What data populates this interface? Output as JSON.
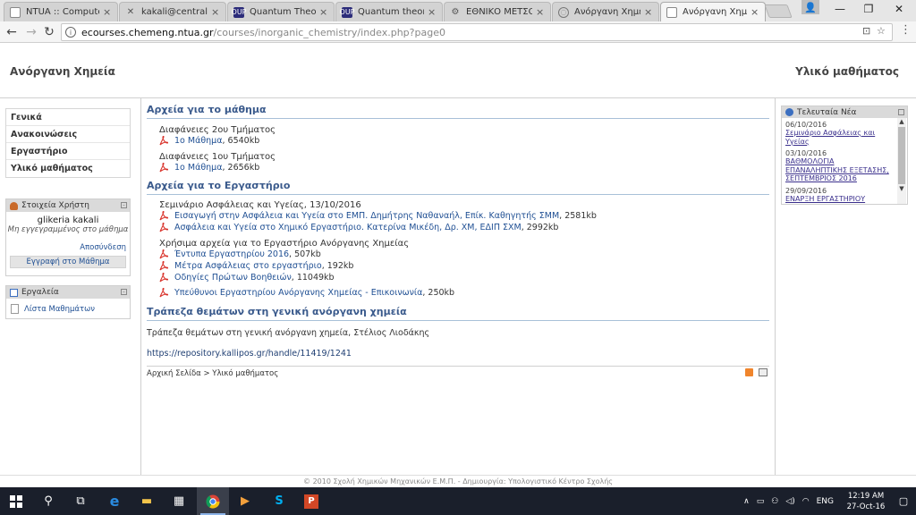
{
  "browser": {
    "tabs": [
      {
        "title": "NTUA :: Computer",
        "fav": "globe-icon",
        "active": false
      },
      {
        "title": "kakali@central.ntua",
        "fav": "mail-icon",
        "active": false
      },
      {
        "title": "Quantum Theory",
        "fav": "oup-icon",
        "active": false
      },
      {
        "title": "Quantum theory -",
        "fav": "oup-icon",
        "active": false
      },
      {
        "title": "ΕΘΝΙΚΟ ΜΕΤΣΟΒΙ",
        "fav": "ntua-icon",
        "active": false
      },
      {
        "title": "Ανόργανη Χημεία",
        "fav": "globe-icon",
        "active": false
      },
      {
        "title": "Ανόργανη Χημεία",
        "fav": "page-icon",
        "active": true
      }
    ],
    "oup_label": "OUP",
    "url_host": "ecourses.chemeng.ntua.gr",
    "url_path": "/courses/inorganic_chemistry/index.php?page0"
  },
  "header": {
    "title": "Ανόργανη Χημεία",
    "right": "Υλικό μαθήματος"
  },
  "sidebar": {
    "menu": [
      "Γενικά",
      "Ανακοινώσεις",
      "Εργαστήριο",
      "Υλικό μαθήματος"
    ],
    "user_block": {
      "title": "Στοιχεία Χρήστη",
      "name": "glikeria kakali",
      "status": "Μη εγγεγραμμένος στο μάθημα",
      "logout": "Αποσύνδεση",
      "enroll": "Εγγραφή στο Μάθημα"
    },
    "tools_block": {
      "title": "Εργαλεία",
      "link": "Λίστα Μαθημάτων"
    }
  },
  "main": {
    "section1": {
      "title": "Αρχεία για το μάθημα",
      "groups": [
        {
          "heading": "Διαφάνειες 2ου Τμήματος",
          "link": "1ο Μάθημα",
          "size": ", 6540kb"
        },
        {
          "heading": "Διαφάνειες 1ου Τμήματος",
          "link": "1ο Μάθημα",
          "size": ", 2656kb"
        }
      ]
    },
    "section2": {
      "title": "Αρχεία για το Εργαστήριο",
      "group1": {
        "heading": "Σεμινάριο Ασφάλειας και Υγείας, 13/10/2016",
        "items": [
          {
            "link": "Εισαγωγή στην Ασφάλεια και Υγεία στο ΕΜΠ. Δημήτρης Ναθαναήλ, Επίκ. Καθηγητής ΣΜΜ",
            "size": ", 2581kb"
          },
          {
            "link": "Ασφάλεια και Υγεία στο Χημικό Εργαστήριο. Κατερίνα Μικέδη, Δρ. ΧΜ, ΕΔΙΠ ΣΧΜ",
            "size": ", 2992kb"
          }
        ]
      },
      "group2": {
        "heading": "Χρήσιμα αρχεία για το Εργαστήριο Ανόργανης Χημείας",
        "items": [
          {
            "link": "Έντυπα Εργαστηρίου 2016",
            "size": ", 507kb"
          },
          {
            "link": "Μέτρα Ασφάλειας στο εργαστήριο",
            "size": ", 192kb"
          },
          {
            "link": "Οδηγίες Πρώτων Βοηθειών",
            "size": ", 11049kb"
          },
          {
            "link": "Υπεύθυνοι Εργαστηρίου Ανόργανης Χημείας - Επικοινωνία",
            "size": ", 250kb"
          }
        ]
      }
    },
    "section3": {
      "title": "Τράπεζα θεμάτων στη γενική ανόργανη χημεία",
      "text": "Τράπεζα θεμάτων στη γενική ανόργανη χημεία, Στέλιος Λιοδάκης",
      "url": "https://repository.kallipos.gr/handle/11419/1241"
    },
    "breadcrumb": "Αρχική Σελίδα > Υλικό μαθήματος"
  },
  "news": {
    "title": "Τελευταία Νέα",
    "items": [
      {
        "date": "06/10/2016",
        "title": "Σεμινάριο Ασφάλειας και Υγείας"
      },
      {
        "date": "03/10/2016",
        "title": "ΒΑΘΜΟΛΟΓΙΑ ΕΠΑΝΑΛΗΠΤΙΚΗΣ ΕΞΕΤΑΣΗΣ, ΣΕΠΤΕΜΒΡΙΟΣ 2016"
      },
      {
        "date": "29/09/2016",
        "title": "ΕΝΑΡΞΗ ΕΡΓΑΣΤΗΡΙΟΥ ΑΝΟΡΓΑΝΗΣ ΧΗΜΕΙΑΣ"
      }
    ]
  },
  "footer": "© 2010 Σχολή Χημικών Μηχανικών Ε.Μ.Π. - Δημιουργία: Υπολογιστικό Κέντρο Σχολής",
  "taskbar": {
    "lang": "ENG",
    "time": "12:19 AM",
    "date": "27-Oct-16"
  },
  "colors": {
    "link": "#1f4f93",
    "section_heading": "#3a5a8c",
    "taskbar": "#1a1f2b"
  }
}
